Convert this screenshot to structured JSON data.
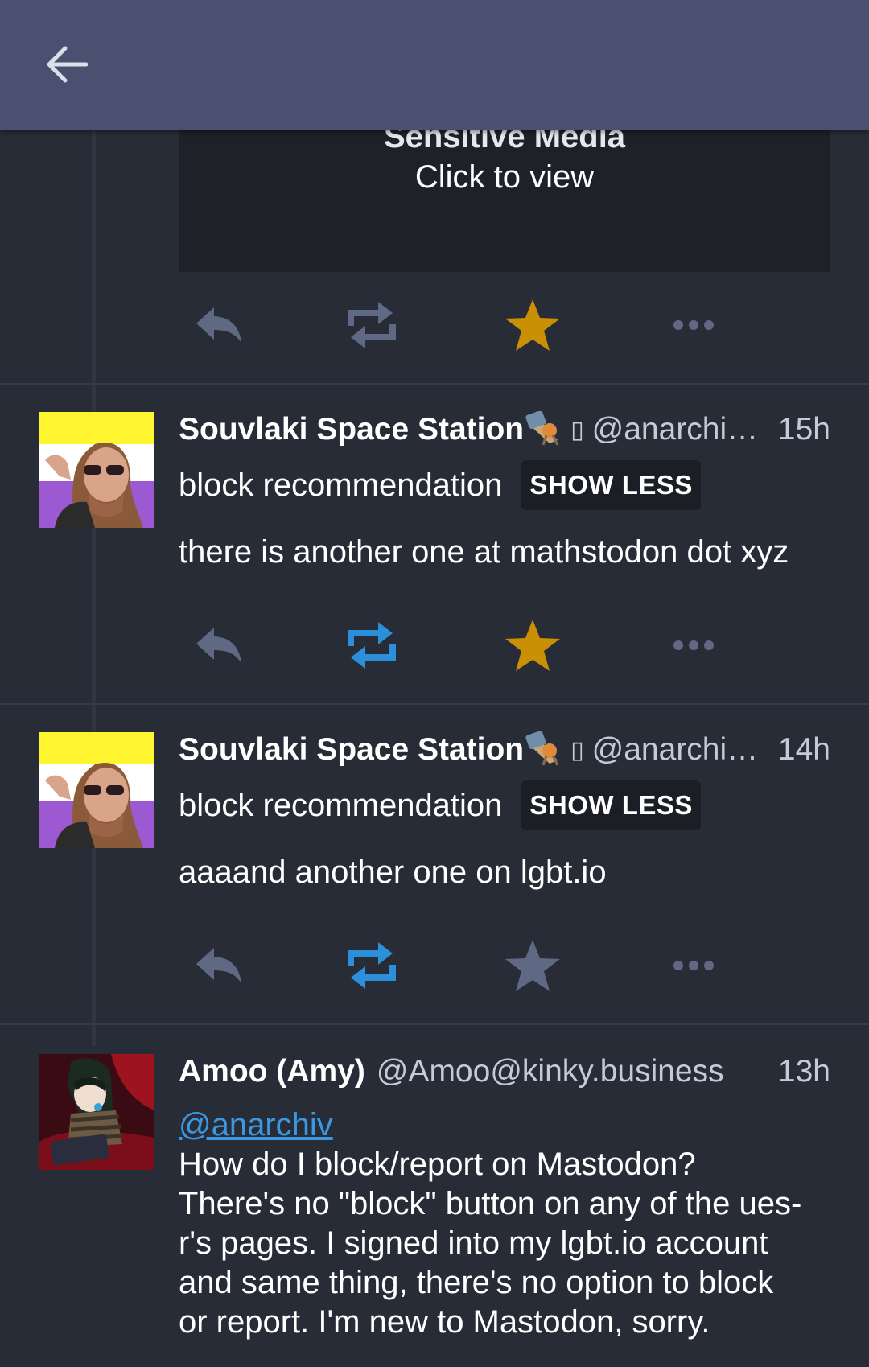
{
  "topbar": {
    "back_icon": "arrow-left-icon"
  },
  "colors": {
    "background": "#282c37",
    "topbar": "#4a5070",
    "favourited": "#ca8f04",
    "boosted": "#2b90d9",
    "inactive_icon": "#606984",
    "mention": "#3a98e1"
  },
  "statuses": [
    {
      "sensitive": {
        "title": "Sensitive Media",
        "subtitle": "Click to view"
      },
      "boosted": false,
      "favourited": true
    },
    {
      "display_name": "Souvlaki Space Station",
      "acct": "@anarchi…",
      "time": "15h",
      "spoiler": "block recommendation",
      "toggle_label": "SHOW LESS",
      "content": "there is another one at mathstodon dot xyz",
      "boosted": true,
      "favourited": true
    },
    {
      "display_name": "Souvlaki Space Station",
      "acct": "@anarchi…",
      "time": "14h",
      "spoiler": "block recommendation",
      "toggle_label": "SHOW LESS",
      "content": "aaaand another one on lgbt.io",
      "boosted": true,
      "favourited": false
    },
    {
      "display_name": "Amoo (Amy)",
      "acct": "@Amoo@kinky.business",
      "time": "13h",
      "mention": "@anarchiv",
      "content_lines": [
        "How do I block/report on Mastodon?",
        "There's no \"block\" button on any of the ues-",
        "r's pages. I signed into my lgbt.io account",
        "and same thing, there's no option to block",
        "or report. I'm new to Mastodon, sorry."
      ]
    }
  ]
}
